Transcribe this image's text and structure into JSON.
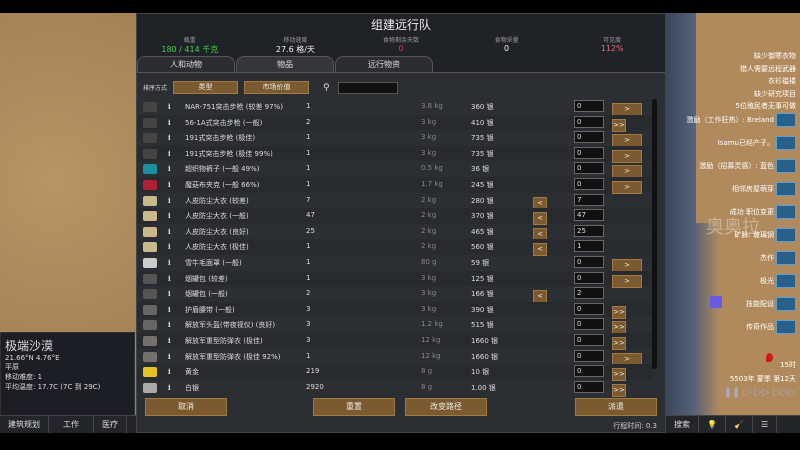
{
  "dialog": {
    "title": "组建远行队",
    "stats": [
      {
        "label": "载重",
        "value": "180 / 414 千克",
        "color": "#3fd23f"
      },
      {
        "label": "移动速度",
        "value": "27.6 格/天",
        "color": "#eeeeee"
      },
      {
        "label": "食物剩余天数",
        "value": "0",
        "color": "#e0304a"
      },
      {
        "label": "食物采量",
        "value": "0",
        "color": "#eeeeee"
      },
      {
        "label": "可见度",
        "value": "112%",
        "color": "#e06a80"
      }
    ],
    "tabs": [
      "人和动物",
      "物品",
      "远行物资"
    ],
    "sort_label": "排序方式",
    "sort_type": "类型",
    "sort_value": "市场价值",
    "rows": [
      {
        "icon": "rifle",
        "color": "#444",
        "name": "NAR-751突击步枪 (较差 97%)",
        "count": "1",
        "mass": "3.8 kg",
        "value": "360 银",
        "amount": "0",
        "left": [],
        "right": [
          ">"
        ]
      },
      {
        "icon": "rifle",
        "color": "#444",
        "name": "56-1A式突击步枪 (一般)",
        "count": "2",
        "mass": "3 kg",
        "value": "410 银",
        "amount": "0",
        "left": [],
        "right": [
          ">",
          ">>"
        ]
      },
      {
        "icon": "rifle",
        "color": "#444",
        "name": "191式突击步枪 (极佳)",
        "count": "1",
        "mass": "3 kg",
        "value": "735 银",
        "amount": "0",
        "left": [],
        "right": [
          ">"
        ]
      },
      {
        "icon": "rifle",
        "color": "#444",
        "name": "191式突击步枪 (极佳 99%)",
        "count": "1",
        "mass": "3 kg",
        "value": "735 银",
        "amount": "0",
        "left": [],
        "right": [
          ">"
        ]
      },
      {
        "icon": "pants",
        "color": "#1a8fa0",
        "name": "超织物裤子 (一般 49%)",
        "count": "1",
        "mass": "0.5 kg",
        "value": "36 银",
        "amount": "0",
        "left": [],
        "right": [
          ">"
        ]
      },
      {
        "icon": "jacket",
        "color": "#b02030",
        "name": "魔菇布夹克 (一般 66%)",
        "count": "1",
        "mass": "1.7 kg",
        "value": "245 银",
        "amount": "0",
        "left": [],
        "right": [
          ">"
        ]
      },
      {
        "icon": "duster",
        "color": "#c8b88a",
        "name": "人皮防尘大衣 (较差)",
        "count": "7",
        "mass": "2 kg",
        "value": "280 银",
        "amount": "7",
        "left": [
          "0",
          "<"
        ],
        "right": []
      },
      {
        "icon": "duster",
        "color": "#c8b88a",
        "name": "人皮防尘大衣 (一般)",
        "count": "47",
        "mass": "2 kg",
        "value": "370 银",
        "amount": "47",
        "left": [
          "0",
          "<"
        ],
        "right": []
      },
      {
        "icon": "duster",
        "color": "#c8b88a",
        "name": "人皮防尘大衣 (良好)",
        "count": "25",
        "mass": "2 kg",
        "value": "465 银",
        "amount": "25",
        "left": [
          "0",
          "<"
        ],
        "right": []
      },
      {
        "icon": "duster",
        "color": "#c8b88a",
        "name": "人皮防尘大衣 (极佳)",
        "count": "1",
        "mass": "2 kg",
        "value": "560 银",
        "amount": "1",
        "left": [
          "<"
        ],
        "right": []
      },
      {
        "icon": "mask",
        "color": "#ccc",
        "name": "雪牛毛面罩 (一般)",
        "count": "1",
        "mass": "80 g",
        "value": "59 银",
        "amount": "0",
        "left": [],
        "right": [
          ">"
        ]
      },
      {
        "icon": "pack",
        "color": "#555",
        "name": "烟罐包 (较差)",
        "count": "1",
        "mass": "3 kg",
        "value": "125 银",
        "amount": "0",
        "left": [],
        "right": [
          ">"
        ]
      },
      {
        "icon": "pack",
        "color": "#555",
        "name": "烟罐包 (一般)",
        "count": "2",
        "mass": "3 kg",
        "value": "166 银",
        "amount": "2",
        "left": [
          "0",
          "<"
        ],
        "right": []
      },
      {
        "icon": "belt",
        "color": "#666",
        "name": "护盾腰带 (一般)",
        "count": "3",
        "mass": "3 kg",
        "value": "390 银",
        "amount": "0",
        "left": [],
        "right": [
          ">",
          ">>"
        ]
      },
      {
        "icon": "helmet",
        "color": "#666",
        "name": "解放军头盔(带夜视仪) (良好)",
        "count": "3",
        "mass": "1.2 kg",
        "value": "515 银",
        "amount": "0",
        "left": [],
        "right": [
          ">",
          ">>"
        ]
      },
      {
        "icon": "armor",
        "color": "#77706a",
        "name": "解放军重型防弹衣 (极佳)",
        "count": "3",
        "mass": "12 kg",
        "value": "1660 银",
        "amount": "0",
        "left": [],
        "right": [
          ">",
          ">>"
        ]
      },
      {
        "icon": "armor",
        "color": "#77706a",
        "name": "解放军重型防弹衣 (极佳 92%)",
        "count": "1",
        "mass": "12 kg",
        "value": "1660 银",
        "amount": "0",
        "left": [],
        "right": [
          ">"
        ]
      },
      {
        "icon": "gold",
        "color": "#e8c020",
        "name": "黄金",
        "count": "219",
        "mass": "8 g",
        "value": "10 银",
        "amount": "0",
        "left": [],
        "right": [
          ">",
          ">>"
        ]
      },
      {
        "icon": "silver",
        "color": "#aaa",
        "name": "白银",
        "count": "2920",
        "mass": "8 g",
        "value": "1.00 银",
        "amount": "0",
        "left": [],
        "right": [
          ">",
          ">>"
        ]
      }
    ],
    "cancel": "取消",
    "reset": "重置",
    "change_route": "改变路径",
    "send": "派遣",
    "travel_time": "行程时间: 0.3"
  },
  "location": {
    "name": "极端沙漠",
    "coords": "21.66°N 4.76°E",
    "terrain": "平原",
    "move_difficulty": "移动难度: 1",
    "avg_temp": "平均温度: 17.7C (7C 到 29C)"
  },
  "bottom_tabs": [
    "建筑规划",
    "工作",
    "医疗"
  ],
  "bottom_right": [
    "搜索"
  ],
  "notifications": [
    "缺少御寒衣物",
    "猎人需要远程武器",
    "衣衫褴褛",
    "缺少研究项目",
    "5位殖民者无事可做"
  ],
  "alerts": [
    "激励（工作狂热）: Breland",
    "Isamu已经产子。",
    "激励（招募灵感）: 蓝色",
    "相邻房屋萌芽",
    "成功 职位变更",
    "矿脉: 玻璃钢",
    "杰作",
    "极光",
    "技能配设",
    "传奇作品"
  ],
  "map_label": "奥奥拉",
  "time": "15时",
  "date": "5503年 蒙季 第12天"
}
